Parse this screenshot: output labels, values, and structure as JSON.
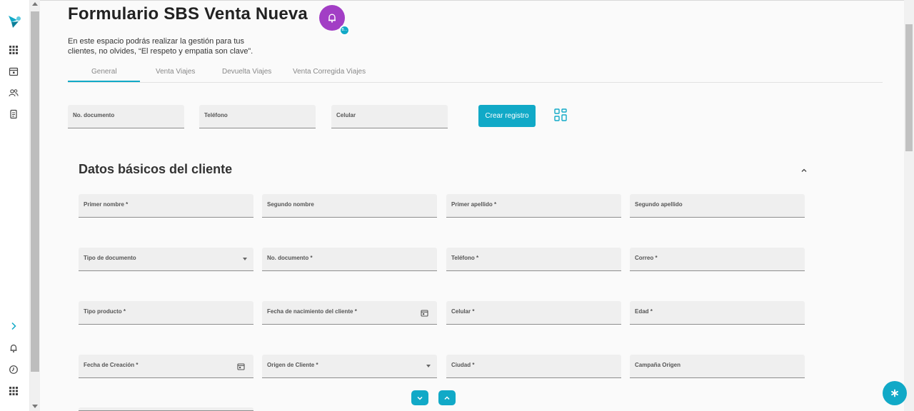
{
  "page": {
    "title": "Formulario SBS Venta Nueva",
    "subtitle": "En este espacio podrás realizar la gestión para tus clientes, no olvides, “El respeto y empatia son clave”.",
    "bell_badge_text": "B..."
  },
  "tabs": [
    {
      "label": "General",
      "active": true
    },
    {
      "label": "Venta Viajes",
      "active": false
    },
    {
      "label": "Devuelta Viajes",
      "active": false
    },
    {
      "label": "Venta Corregida Viajes",
      "active": false
    }
  ],
  "search": {
    "fields": [
      {
        "label": "No. documento"
      },
      {
        "label": "Teléfono"
      },
      {
        "label": "Celular"
      }
    ],
    "create_button": "Crear registro"
  },
  "section": {
    "title": "Datos básicos del cliente",
    "fields": [
      {
        "label": "Primer nombre *",
        "kind": "text"
      },
      {
        "label": "Segundo nombre",
        "kind": "text"
      },
      {
        "label": "Primer apellido *",
        "kind": "text"
      },
      {
        "label": "Segundo apellido",
        "kind": "text"
      },
      {
        "label": "Tipo de documento",
        "kind": "select"
      },
      {
        "label": "No. documento *",
        "kind": "text"
      },
      {
        "label": "Teléfono *",
        "kind": "text"
      },
      {
        "label": "Correo *",
        "kind": "text"
      },
      {
        "label": "Tipo producto *",
        "kind": "text"
      },
      {
        "label": "Fecha de nacimiento del cliente *",
        "kind": "date"
      },
      {
        "label": "Celular *",
        "kind": "text"
      },
      {
        "label": "Edad *",
        "kind": "text"
      },
      {
        "label": "Fecha de Creación *",
        "kind": "date"
      },
      {
        "label": "Origen de Cliente *",
        "kind": "select"
      },
      {
        "label": "Ciudad *",
        "kind": "text"
      },
      {
        "label": "Campaña Origen",
        "kind": "text"
      }
    ]
  },
  "colors": {
    "accent": "#11a9c7",
    "bell_button": "#a23ec5",
    "field_bg": "#efefef"
  },
  "icons": {
    "rail_top": [
      "apps-grid-icon",
      "calendar-icon",
      "users-icon",
      "document-icon"
    ],
    "rail_bottom": [
      "chevron-right-icon",
      "bell-icon",
      "clock-icon",
      "apps-grid-icon"
    ]
  }
}
